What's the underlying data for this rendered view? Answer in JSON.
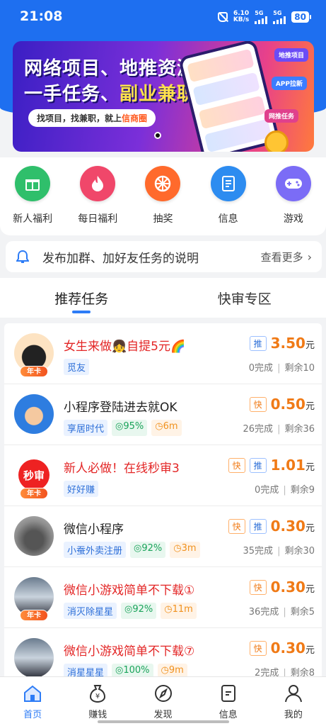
{
  "status_bar": {
    "time": "21:08",
    "speed": "6.10",
    "speed_unit": "KB/s",
    "sig1": "5G",
    "sig2": "5G",
    "battery": "80"
  },
  "banner": {
    "line1": "网络项目、地推资源",
    "line2_a": "一手任务、",
    "line2_b": "副业兼职",
    "pill_a": "找项目，找兼职，就上",
    "pill_b": "信商圈",
    "tag1": "地推项目",
    "tag2": "APP拉新",
    "tag3": "网推任务"
  },
  "shortcuts": [
    {
      "label": "新人福利",
      "color": "#2fbf6b",
      "icon": "gift-icon"
    },
    {
      "label": "每日福利",
      "color": "#f0476a",
      "icon": "flame-icon"
    },
    {
      "label": "抽奖",
      "color": "#ff6a2c",
      "icon": "wheel-icon"
    },
    {
      "label": "信息",
      "color": "#2d8cf0",
      "icon": "document-icon"
    },
    {
      "label": "游戏",
      "color": "#7b6cf6",
      "icon": "gamepad-icon"
    }
  ],
  "notice": {
    "text": "发布加群、加好友任务的说明",
    "more": "查看更多"
  },
  "tabs": [
    {
      "label": "推荐任务",
      "active": true
    },
    {
      "label": "快审专区",
      "active": false
    }
  ],
  "tasks": [
    {
      "title": "女生来做👧自提5元🌈",
      "red": true,
      "year_badge": "年卡",
      "tags": [
        "觅友"
      ],
      "rate": "",
      "time": "",
      "marks": [
        "推"
      ],
      "price": "3.50",
      "unit": "元",
      "done": "0完成",
      "left": "剩余10"
    },
    {
      "title": "小程序登陆进去就OK",
      "red": false,
      "year_badge": "",
      "tags": [
        "享居时代"
      ],
      "rate": "95%",
      "time": "6m",
      "marks": [
        "快"
      ],
      "price": "0.50",
      "unit": "元",
      "done": "26完成",
      "left": "剩余36"
    },
    {
      "title": "新人必做！在线秒审3",
      "red": true,
      "year_badge": "年卡",
      "avatar_text": "秒审",
      "tags": [
        "好好赚"
      ],
      "rate": "",
      "time": "",
      "marks": [
        "快",
        "推"
      ],
      "price": "1.01",
      "unit": "元",
      "done": "0完成",
      "left": "剩余9"
    },
    {
      "title": "微信小程序",
      "red": false,
      "year_badge": "",
      "tags": [
        "小蚕外卖注册"
      ],
      "rate": "92%",
      "time": "3m",
      "marks": [
        "快",
        "推"
      ],
      "price": "0.30",
      "unit": "元",
      "done": "35完成",
      "left": "剩余30"
    },
    {
      "title": "微信小游戏简单不下载①",
      "red": true,
      "year_badge": "年卡",
      "tags": [
        "消灭除星星"
      ],
      "rate": "92%",
      "time": "11m",
      "marks": [
        "快"
      ],
      "price": "0.30",
      "unit": "元",
      "done": "36完成",
      "left": "剩余5"
    },
    {
      "title": "微信小游戏简单不下载⑦",
      "red": true,
      "year_badge": "",
      "tags": [
        "消星星星"
      ],
      "rate": "100%",
      "time": "9m",
      "marks": [
        "快"
      ],
      "price": "0.30",
      "unit": "元",
      "done": "2完成",
      "left": "剩余8"
    }
  ],
  "bottom_nav": [
    {
      "label": "首页",
      "active": true,
      "icon": "home-icon"
    },
    {
      "label": "赚钱",
      "active": false,
      "icon": "money-bag-icon"
    },
    {
      "label": "发现",
      "active": false,
      "icon": "compass-icon"
    },
    {
      "label": "信息",
      "active": false,
      "icon": "message-icon"
    },
    {
      "label": "我的",
      "active": false,
      "icon": "profile-icon"
    }
  ]
}
